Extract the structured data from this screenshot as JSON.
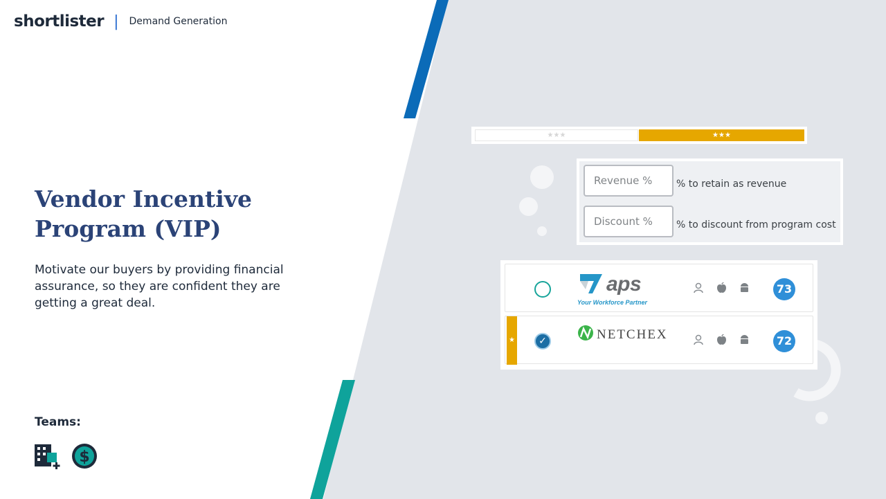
{
  "header": {
    "logo": "shortlister",
    "separator": "|",
    "section": "Demand Generation"
  },
  "main": {
    "title": "Vendor Incentive Program (VIP)",
    "description": "Motivate our buyers by providing financial assurance, so they are confident they are getting a great deal."
  },
  "teams": {
    "label": "Teams:",
    "icons": [
      "building-plus-icon",
      "dollar-circle-icon"
    ]
  },
  "stars_bar": {
    "left_stars": "★★★",
    "right_stars": "★★★"
  },
  "incentives": [
    {
      "field": "Revenue %",
      "text": "% to retain as revenue"
    },
    {
      "field": "Discount %",
      "text": "% to discount from program cost"
    }
  ],
  "vendors": [
    {
      "name": "aps",
      "tagline": "Your Workforce Partner",
      "selected": false,
      "score": "73",
      "starred": false
    },
    {
      "name": "NETCHEX",
      "tagline": "",
      "selected": true,
      "score": "72",
      "starred": true,
      "star": "★",
      "check": "✓"
    }
  ],
  "colors": {
    "accent_blue": "#0b6bb8",
    "accent_teal": "#0fa39b",
    "title": "#2b4377",
    "gold": "#e6a700",
    "score_blue": "#2f8fd8"
  }
}
